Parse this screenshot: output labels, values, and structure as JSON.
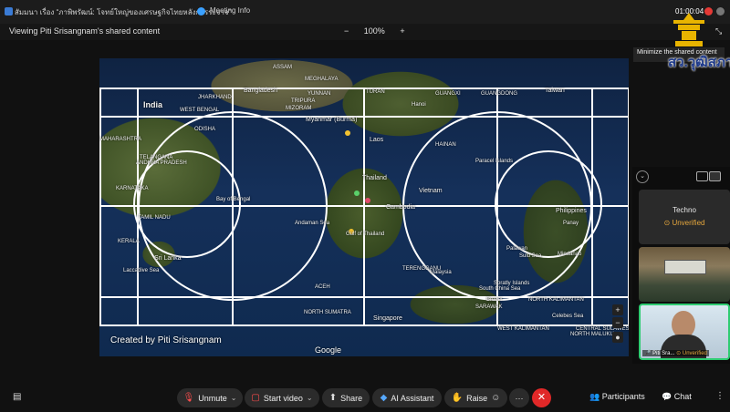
{
  "titlebar": {
    "title": "สัมมนา เรื่อง “ภาพิพรัฒน์: โจทย์ใหญ่ของเศรษฐกิจไทยหลังการระจาจ”",
    "meeting_info": "Meeting Info",
    "timer": "01:00:04"
  },
  "view": {
    "viewing_label": "Viewing Piti Srisangnam's shared content",
    "zoom_minus": "−",
    "zoom": "100%",
    "zoom_plus": "+"
  },
  "tooltip": "Minimize the shared content",
  "logo": {
    "text": "สว.วุฒิสภา"
  },
  "map": {
    "credit": "Created by Piti Srisangnam",
    "attribution": "Google",
    "labels": [
      {
        "text": "India",
        "cls": "big"
      },
      {
        "text": "Bangladesh",
        "cls": "mid"
      },
      {
        "text": "ASSAM",
        "cls": ""
      },
      {
        "text": "MEGHALAYA",
        "cls": ""
      },
      {
        "text": "JHARKHAND",
        "cls": ""
      },
      {
        "text": "WEST BENGAL",
        "cls": ""
      },
      {
        "text": "MIZORAM",
        "cls": ""
      },
      {
        "text": "TRIPURA",
        "cls": ""
      },
      {
        "text": "ODISHA",
        "cls": ""
      },
      {
        "text": "MAHARASHTRA",
        "cls": ""
      },
      {
        "text": "TELANGANA",
        "cls": ""
      },
      {
        "text": "ANDHRA PRADESH",
        "cls": ""
      },
      {
        "text": "KARNATAKA",
        "cls": ""
      },
      {
        "text": "TAMIL NADU",
        "cls": ""
      },
      {
        "text": "KERALA",
        "cls": ""
      },
      {
        "text": "Sri Lanka",
        "cls": "mid"
      },
      {
        "text": "Laccadive Sea",
        "cls": ""
      },
      {
        "text": "Bay of Bengal",
        "cls": ""
      },
      {
        "text": "Andaman Sea",
        "cls": ""
      },
      {
        "text": "Myanmar (Burma)",
        "cls": "mid"
      },
      {
        "text": "Laos",
        "cls": "mid"
      },
      {
        "text": "Thailand",
        "cls": "mid"
      },
      {
        "text": "Cambodia",
        "cls": "mid"
      },
      {
        "text": "Vietnam",
        "cls": "mid"
      },
      {
        "text": "Hanoi",
        "cls": ""
      },
      {
        "text": "GUANGXI",
        "cls": ""
      },
      {
        "text": "GUANGDONG",
        "cls": ""
      },
      {
        "text": "YUNNAN",
        "cls": ""
      },
      {
        "text": "HAINAN",
        "cls": ""
      },
      {
        "text": "Taiwan",
        "cls": "mid"
      },
      {
        "text": "Philippines",
        "cls": "mid"
      },
      {
        "text": "Panay",
        "cls": ""
      },
      {
        "text": "Sulu Sea",
        "cls": ""
      },
      {
        "text": "Palawan",
        "cls": ""
      },
      {
        "text": "Mindanao",
        "cls": ""
      },
      {
        "text": "South China Sea",
        "cls": ""
      },
      {
        "text": "Paracel Islands",
        "cls": ""
      },
      {
        "text": "Spratly Islands",
        "cls": ""
      },
      {
        "text": "Gulf of Thailand",
        "cls": ""
      },
      {
        "text": "ACEH",
        "cls": ""
      },
      {
        "text": "TERENGGANU",
        "cls": ""
      },
      {
        "text": "Malaysia",
        "cls": ""
      },
      {
        "text": "Singapore",
        "cls": "mid"
      },
      {
        "text": "NORTH SUMATRA",
        "cls": ""
      },
      {
        "text": "SARAWAK",
        "cls": ""
      },
      {
        "text": "Brunei",
        "cls": ""
      },
      {
        "text": "NORTH KALIMANTAN",
        "cls": ""
      },
      {
        "text": "WEST KALIMANTAN",
        "cls": ""
      },
      {
        "text": "CENTRAL SULAWESI",
        "cls": ""
      },
      {
        "text": "Celebes Sea",
        "cls": ""
      },
      {
        "text": "NORTH MALUKU",
        "cls": ""
      },
      {
        "text": "TURAN",
        "cls": ""
      }
    ]
  },
  "participants": [
    {
      "name": "Techno",
      "status": "Unverified"
    },
    {
      "name": "",
      "status": ""
    },
    {
      "name": "Piti Sra...",
      "status": "Unverified"
    }
  ],
  "toolbar": {
    "unmute": "Unmute",
    "start_video": "Start video",
    "share": "Share",
    "ai_assistant": "AI Assistant",
    "raise": "Raise",
    "more": "···",
    "participants": "Participants",
    "chat": "Chat"
  }
}
